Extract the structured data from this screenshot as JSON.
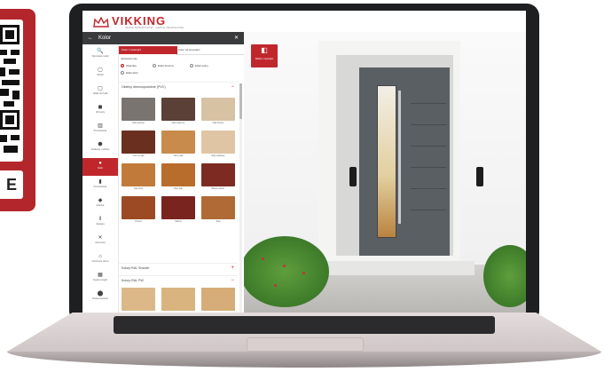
{
  "qr_card": {
    "label": "E"
  },
  "app": {
    "brand": "VIKKING",
    "tagline": "DRZWI ZEWNĘTRZNE · CIEPŁE I BEZPIECZNE",
    "panel": {
      "back_icon": "←",
      "title": "Kolor",
      "close_icon": "✕"
    },
    "sidebar": [
      {
        "icon": "🔍",
        "label": "Wyszukaj model"
      },
      {
        "icon": "▢",
        "label": "Model"
      },
      {
        "icon": "▢",
        "label": "Układ skrzydła"
      },
      {
        "icon": "◼",
        "label": "Wymiary"
      },
      {
        "icon": "▥",
        "label": "Przeszklenie"
      },
      {
        "icon": "⬣",
        "label": "Aplikacje i ozdoby"
      },
      {
        "icon": "●",
        "label": "Kolor"
      },
      {
        "icon": "▮",
        "label": "Przeszklenie"
      },
      {
        "icon": "◆",
        "label": "Klamka"
      },
      {
        "icon": "‖",
        "label": "Zawiasy"
      },
      {
        "icon": "✕",
        "label": "Akcesoria"
      },
      {
        "icon": "⌂",
        "label": "Otoczenie domu"
      },
      {
        "icon": "▦",
        "label": "Zapisz projekt"
      },
      {
        "icon": "⬤",
        "label": "Podsumowanie"
      }
    ],
    "tabs": {
      "active": "Kolor z zewnątrz",
      "inactive": "Kolor od wewnątrz"
    },
    "subtitle": "Jednostronnie",
    "radios": [
      "Okleinka",
      "Efekt drewna",
      "Efekt pełny",
      "Efekt farbi"
    ],
    "section_wood": {
      "title": "Okleiny drewnopodobne (PVC)",
      "sign": "−"
    },
    "section_ral_smooth": {
      "title": "Kolory RAL Smooth",
      "sign": "+"
    },
    "section_ral_pw": {
      "title": "Kolory RAL PW",
      "sign": "−"
    },
    "swatches": [
      {
        "name": "Dąb antracyt",
        "color": "#7a7470"
      },
      {
        "name": "Dąb bagienny",
        "color": "#5a4036"
      },
      {
        "name": "Dąb bielony",
        "color": "#d8c2a4"
      },
      {
        "name": "Ciemny dąb",
        "color": "#6a2f1e"
      },
      {
        "name": "Jasny dąb",
        "color": "#c88b4c"
      },
      {
        "name": "Dąb piaskowy",
        "color": "#e0c5a4"
      },
      {
        "name": "Dąb złoty",
        "color": "#c27a3a"
      },
      {
        "name": "Złoty dąb",
        "color": "#b86d2c"
      },
      {
        "name": "Wiśnia szlach.",
        "color": "#7d2a22"
      },
      {
        "name": "Orzech",
        "color": "#9c4a23"
      },
      {
        "name": "Mahoń",
        "color": "#7a2420"
      },
      {
        "name": "Teak",
        "color": "#b06a35"
      }
    ],
    "swatches_bottom": [
      {
        "color": "#dcb889"
      },
      {
        "color": "#d9b47e"
      },
      {
        "color": "#d6ad78"
      }
    ],
    "cta": {
      "icon": "◧",
      "label": "Widok z zewnątrz"
    }
  }
}
